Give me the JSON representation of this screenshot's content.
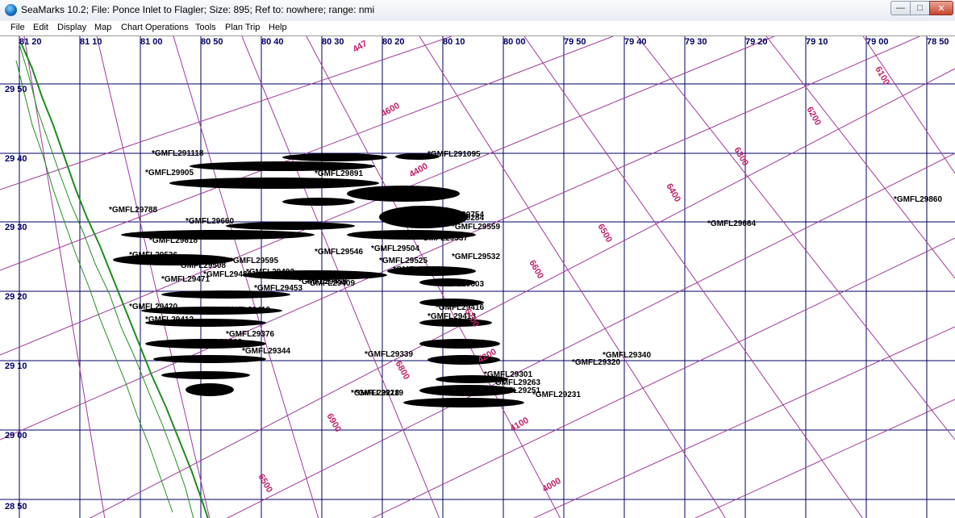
{
  "window": {
    "title": "SeaMarks  10.2;  File: Ponce Inlet to Flagler;  Size:  895;   Ref to: nowhere;   range: nmi",
    "app_icon": "globe-icon",
    "controls": {
      "minimize": "—",
      "maximize": "□",
      "close": "✕"
    }
  },
  "menu": [
    "File",
    "Edit",
    "Display",
    "Map",
    "Chart Operations",
    "Tools",
    "Plan Trip",
    "Help"
  ],
  "colors": {
    "grid": "#000066",
    "loran": "#a0399a",
    "loran_label": "#c0206a",
    "coast": "#1e8c1e",
    "markers": "#000000"
  },
  "map": {
    "longitude_labels": [
      "81 20",
      "81 10",
      "81 00",
      "80 50",
      "80 40",
      "80 30",
      "80 20",
      "80 10",
      "80 00",
      "79 50",
      "79 40",
      "79 30",
      "79 20",
      "79 10",
      "79 00",
      "78 50"
    ],
    "latitude_labels": [
      "29 50",
      "29 40",
      "29 30",
      "29 20",
      "29 10",
      "29 00",
      "28 50"
    ],
    "loran_labels": [
      "447",
      "4600",
      "4400",
      "4200",
      "4100",
      "4000",
      "6100",
      "6200",
      "6300",
      "6400",
      "6500",
      "6600",
      "6700",
      "6800",
      "6900",
      "6500"
    ],
    "waypoints": [
      "*GMFL29860",
      "*GMFL29664",
      "*GMFL29340",
      "*GMFL29320",
      "*GMFL29231",
      "*GMFL29339",
      "*GMFL29413",
      "*GMFL29416",
      "*GMFL29496",
      "*GMFL29459",
      "*GMFL29493",
      "*GMFL29486",
      "*GMFL29471",
      "*GMFL29508",
      "*GMFL29536",
      "*GMFL29595",
      "*GMFL29634",
      "*GMFL29905",
      "*GMFL29788",
      "*GMFL29420",
      "*GMFL29412",
      "*GMFL29368",
      "*GMFL29301",
      "*GMFL29263",
      "*GMFL29251",
      "*GMFL29532",
      "*GMFL29559",
      "*GMFL29754",
      "*GMFL29284",
      "*GMFL291095",
      "*GMFL291118",
      "*GMFL29891",
      "*GMFL29660",
      "*GMFL29618",
      "*GMFL29537",
      "*GMFL29546",
      "*GMFL29525",
      "*GMFL29504",
      "*GMFL29453",
      "*GMFL29419",
      "*GMFL29409",
      "*GMFL29376",
      "*GMFL29344",
      "*GMFL29218",
      "*GMFL29219",
      "*GMFL29603"
    ]
  }
}
